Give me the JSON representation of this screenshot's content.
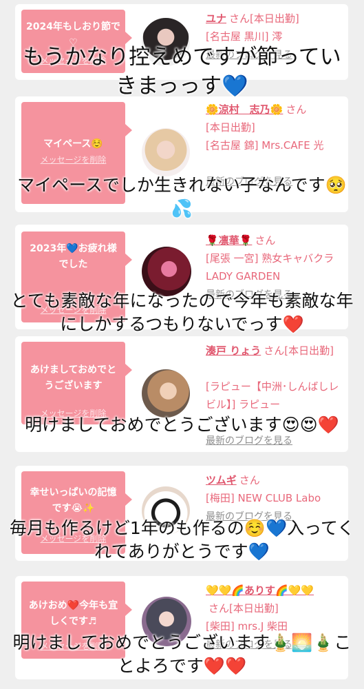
{
  "cards": [
    {
      "bubble_text": "2024年もしおり節で♡",
      "delete_label": "メッセージを削除",
      "name": "ユナ",
      "san": "さん",
      "status": "[本日出勤]",
      "location": "[名古屋 黒川] 澪",
      "blog_link": "最新のブログを見る"
    },
    {
      "bubble_text": "マイペース☺️",
      "delete_label": "メッセージを削除",
      "name": "🌼涼村　志乃🌼",
      "san": "さん",
      "status": "[本日出勤]",
      "location": "[名古屋 錦] Mrs.CAFE 光",
      "blog_link": "最新のブログを見る"
    },
    {
      "bubble_text": "2023年💙お疲れ様でした",
      "delete_label": "メッセージを削除",
      "name": "🌹凛華🌹",
      "san": "さん",
      "status": "",
      "location": "[尾張 一宮] 熟女キャバクラ LADY GARDEN",
      "blog_link": "最新のブログを見る"
    },
    {
      "bubble_text": "あけましておめでとうございます",
      "delete_label": "メッセージを削除",
      "name": "湊戸 りょう",
      "san": "さん",
      "status": "[本日出勤]",
      "location": "[ラピュー【中洲･しんばしレビル】] ラピュー",
      "blog_link": "最新のブログを見る"
    },
    {
      "bubble_text": "幸せいっぱいの記憶です😭✨",
      "delete_label": "メッセージを削除",
      "name": "ツムギ",
      "san": "さん",
      "status": "",
      "location": "[梅田] NEW CLUB Labo",
      "blog_link": "最新のブログを見る"
    },
    {
      "bubble_text": "あけおめ❤️今年も宜しくです♬",
      "delete_label": "メッセージを削除",
      "name": "💛💛🌈ありす🌈💛💛",
      "san": "さん",
      "status": "[本日出勤]",
      "location": "[柴田] mrs.J 柴田",
      "blog_link": "最新のブログを見る"
    }
  ],
  "captions": [
    "もうかなり控えめですが節っていきまっっす💙",
    "マイペースでしか生きれない子なんです🥺💦",
    "とても素敵な年になったので今年も素敵な年にしかするつもりないでっす❤️",
    "明けましておめでとうございます😍😍❤️",
    "毎月も作るけど1年のも作るの☺️💙入ってくれてありがとうです💙",
    "明けましておめでとうございます🎍🌅🎍ことよろです❤️❤️"
  ],
  "colors": {
    "pink_bubble": "#f5939e",
    "name_pink": "#e0566d",
    "background": "#efefef"
  }
}
